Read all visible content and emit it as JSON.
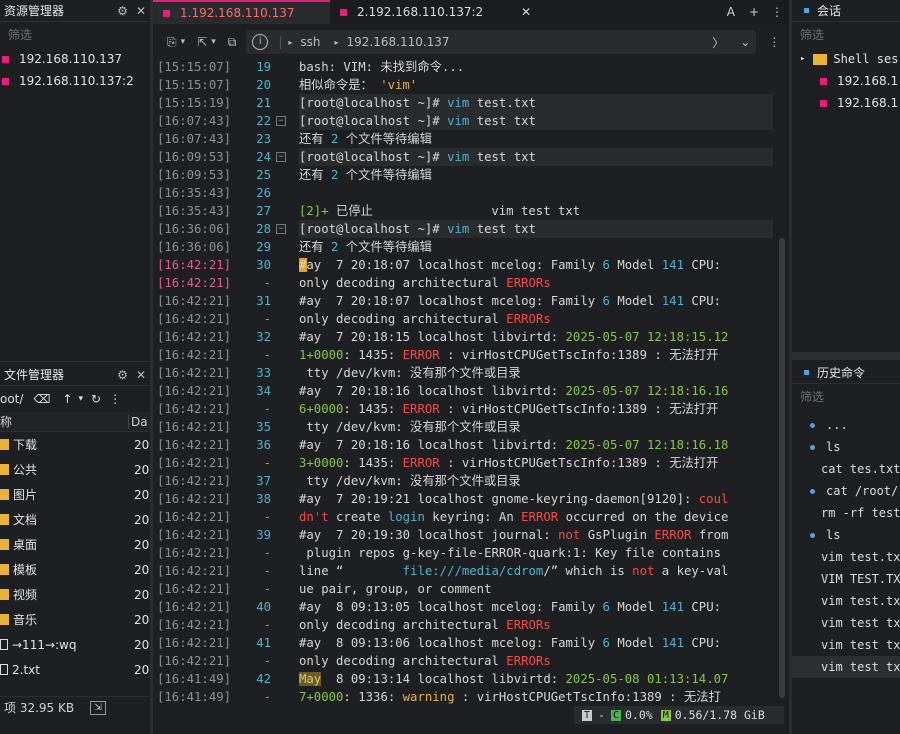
{
  "left_panel": {
    "title": "资源管理器",
    "sessions": [
      "192.168.110.137",
      "192.168.110.137:2"
    ]
  },
  "file_manager": {
    "title": "文件管理器",
    "path": "oot/",
    "col_name": "称",
    "col_date": "Da",
    "items": [
      {
        "name": "下载",
        "date": "20"
      },
      {
        "name": "公共",
        "date": "20"
      },
      {
        "name": "图片",
        "date": "20"
      },
      {
        "name": "文档",
        "date": "20"
      },
      {
        "name": "桌面",
        "date": "20"
      },
      {
        "name": "模板",
        "date": "20"
      },
      {
        "name": "视频",
        "date": "20"
      },
      {
        "name": "音乐",
        "date": "20"
      },
      {
        "name": "→111→:wq",
        "date": "20"
      },
      {
        "name": "2.txt",
        "date": "20"
      }
    ],
    "footer": "项 32.95 KB"
  },
  "tabs": [
    {
      "label": "1.192.168.110.137",
      "active": true
    },
    {
      "label": "2.192.168.110.137:2",
      "active": false
    }
  ],
  "breadcrumb": {
    "protocol": "ssh",
    "host": "192.168.110.137"
  },
  "terminal_lines": [
    {
      "ts": "[15:15:07]",
      "ln": "19",
      "parts": [
        [
          "",
          "bash: VIM: 未找到命令..."
        ]
      ]
    },
    {
      "ts": "[15:15:07]",
      "ln": "20",
      "parts": [
        [
          "",
          "相似命令是： "
        ],
        [
          "org",
          "'vim'"
        ]
      ]
    },
    {
      "ts": "[15:15:19]",
      "ln": "21",
      "hl": true,
      "parts": [
        [
          "",
          "[root@localhost ~]# "
        ],
        [
          "blue",
          "vim"
        ],
        [
          "",
          " test.txt"
        ]
      ]
    },
    {
      "ts": "[16:07:43]",
      "ln": "22",
      "fold": true,
      "hl": true,
      "parts": [
        [
          "",
          "[root@localhost ~]# "
        ],
        [
          "blue",
          "vim"
        ],
        [
          "",
          " test txt"
        ]
      ]
    },
    {
      "ts": "[16:07:43]",
      "ln": "23",
      "parts": [
        [
          "",
          "还有 "
        ],
        [
          "blue",
          "2"
        ],
        [
          "",
          " 个文件等待编辑"
        ]
      ]
    },
    {
      "ts": "[16:09:53]",
      "ln": "24",
      "fold": true,
      "hl": true,
      "parts": [
        [
          "",
          "[root@localhost ~]# "
        ],
        [
          "blue",
          "vim"
        ],
        [
          "",
          " test txt"
        ]
      ]
    },
    {
      "ts": "[16:09:53]",
      "ln": "25",
      "parts": [
        [
          "",
          "还有 "
        ],
        [
          "blue",
          "2"
        ],
        [
          "",
          " 个文件等待编辑"
        ]
      ]
    },
    {
      "ts": "[16:35:43]",
      "ln": "26",
      "parts": [
        [
          "",
          ""
        ]
      ]
    },
    {
      "ts": "[16:35:43]",
      "ln": "27",
      "parts": [
        [
          "grn",
          "[2]+"
        ],
        [
          "",
          " 已停止                vim test txt"
        ]
      ]
    },
    {
      "ts": "[16:36:06]",
      "ln": "28",
      "fold": true,
      "hl": true,
      "parts": [
        [
          "",
          "[root@localhost ~]# "
        ],
        [
          "blue",
          "vim"
        ],
        [
          "",
          " test txt"
        ]
      ]
    },
    {
      "ts": "[16:36:06]",
      "ln": "29",
      "parts": [
        [
          "",
          "还有 "
        ],
        [
          "blue",
          "2"
        ],
        [
          "",
          " 个文件等待编辑"
        ]
      ]
    },
    {
      "ts": "[16:42:21]",
      "ln": "30",
      "tscolor": "#e05f8c",
      "parts": [
        [
          "",
          "#ay  7 20:18:07 localhost mcelog: Family "
        ],
        [
          "blue",
          "6"
        ],
        [
          "",
          " Model "
        ],
        [
          "blue",
          "141"
        ],
        [
          "",
          " CPU: "
        ]
      ]
    },
    {
      "ts": "[16:42:21]",
      "ln": "-",
      "tscolor": "#e05f8c",
      "parts": [
        [
          "",
          "only decoding architectural "
        ],
        [
          "red",
          "ERRORs"
        ]
      ]
    },
    {
      "ts": "[16:42:21]",
      "ln": "31",
      "parts": [
        [
          "",
          "#ay  7 20:18:07 localhost mcelog: Family "
        ],
        [
          "blue",
          "6"
        ],
        [
          "",
          " Model "
        ],
        [
          "blue",
          "141"
        ],
        [
          "",
          " CPU: "
        ]
      ]
    },
    {
      "ts": "[16:42:21]",
      "ln": "-",
      "parts": [
        [
          "",
          "only decoding architectural "
        ],
        [
          "red",
          "ERRORs"
        ]
      ]
    },
    {
      "ts": "[16:42:21]",
      "ln": "32",
      "parts": [
        [
          "",
          "#ay  7 20:18:15 localhost libvirtd: "
        ],
        [
          "grn",
          "2025-05-07 12:18:15.12"
        ]
      ]
    },
    {
      "ts": "[16:42:21]",
      "ln": "-",
      "parts": [
        [
          "grn",
          "1+0000"
        ],
        [
          "",
          ": 1435: "
        ],
        [
          "red",
          "ERROR"
        ],
        [
          "",
          " : virHostCPUGetTscInfo:1389 : 无法打开"
        ]
      ]
    },
    {
      "ts": "[16:42:21]",
      "ln": "33",
      "parts": [
        [
          "",
          " tty /dev/kvm: 没有那个文件或目录"
        ]
      ]
    },
    {
      "ts": "[16:42:21]",
      "ln": "34",
      "parts": [
        [
          "",
          "#ay  7 20:18:16 localhost libvirtd: "
        ],
        [
          "grn",
          "2025-05-07 12:18:16.16"
        ]
      ]
    },
    {
      "ts": "[16:42:21]",
      "ln": "-",
      "parts": [
        [
          "grn",
          "6+0000"
        ],
        [
          "",
          ": 1435: "
        ],
        [
          "red",
          "ERROR"
        ],
        [
          "",
          " : virHostCPUGetTscInfo:1389 : 无法打开"
        ]
      ]
    },
    {
      "ts": "[16:42:21]",
      "ln": "35",
      "parts": [
        [
          "",
          " tty /dev/kvm: 没有那个文件或目录"
        ]
      ]
    },
    {
      "ts": "[16:42:21]",
      "ln": "36",
      "parts": [
        [
          "",
          "#ay  7 20:18:16 localhost libvirtd: "
        ],
        [
          "grn",
          "2025-05-07 12:18:16.18"
        ]
      ]
    },
    {
      "ts": "[16:42:21]",
      "ln": "-",
      "parts": [
        [
          "grn",
          "3+0000"
        ],
        [
          "",
          ": 1435: "
        ],
        [
          "red",
          "ERROR"
        ],
        [
          "",
          " : virHostCPUGetTscInfo:1389 : 无法打开"
        ]
      ]
    },
    {
      "ts": "[16:42:21]",
      "ln": "37",
      "parts": [
        [
          "",
          " tty /dev/kvm: 没有那个文件或目录"
        ]
      ]
    },
    {
      "ts": "[16:42:21]",
      "ln": "38",
      "parts": [
        [
          "",
          "#ay  7 20:19:21 localhost gnome-keyring-daemon[9120]: "
        ],
        [
          "red",
          "coul"
        ]
      ]
    },
    {
      "ts": "[16:42:21]",
      "ln": "-",
      "parts": [
        [
          "red",
          "dn't"
        ],
        [
          "",
          " create "
        ],
        [
          "blue",
          "login"
        ],
        [
          "",
          " keyring: An "
        ],
        [
          "red",
          "ERROR"
        ],
        [
          "",
          " occurred on the device"
        ]
      ]
    },
    {
      "ts": "[16:42:21]",
      "ln": "39",
      "parts": [
        [
          "",
          "#ay  7 20:19:30 localhost journal: "
        ],
        [
          "red",
          "not"
        ],
        [
          "",
          " GsPlugin "
        ],
        [
          "red",
          "ERROR"
        ],
        [
          "",
          " from"
        ]
      ]
    },
    {
      "ts": "[16:42:21]",
      "ln": "-",
      "parts": [
        [
          "",
          " plugin repos g-key-file-ERROR-quark:1: Key file contains "
        ]
      ]
    },
    {
      "ts": "[16:42:21]",
      "ln": "-",
      "parts": [
        [
          "",
          "line “        "
        ],
        [
          "blue",
          "file:///media/cdrom"
        ],
        [
          "",
          "/” which is "
        ],
        [
          "red",
          "not"
        ],
        [
          "",
          " a key-val"
        ]
      ]
    },
    {
      "ts": "[16:42:21]",
      "ln": "-",
      "parts": [
        [
          "",
          "ue pair, group, or comment"
        ]
      ]
    },
    {
      "ts": "[16:42:21]",
      "ln": "40",
      "parts": [
        [
          "",
          "#ay  8 09:13:05 localhost mcelog: Family "
        ],
        [
          "blue",
          "6"
        ],
        [
          "",
          " Model "
        ],
        [
          "blue",
          "141"
        ],
        [
          "",
          " CPU: "
        ]
      ]
    },
    {
      "ts": "[16:42:21]",
      "ln": "-",
      "parts": [
        [
          "",
          "only decoding architectural "
        ],
        [
          "red",
          "ERRORs"
        ]
      ]
    },
    {
      "ts": "[16:42:21]",
      "ln": "41",
      "parts": [
        [
          "",
          "#ay  8 09:13:06 localhost mcelog: Family "
        ],
        [
          "blue",
          "6"
        ],
        [
          "",
          " Model "
        ],
        [
          "blue",
          "141"
        ],
        [
          "",
          " CPU: "
        ]
      ]
    },
    {
      "ts": "[16:42:21]",
      "ln": "-",
      "parts": [
        [
          "",
          "only decoding architectural "
        ],
        [
          "red",
          "ERRORs"
        ]
      ]
    },
    {
      "ts": "[16:41:49]",
      "ln": "42",
      "parts": [
        [
          "yel",
          "May"
        ],
        [
          "",
          "  8 09:13:14 localhost libvirtd: "
        ],
        [
          "grn",
          "2025-05-08 01:13:14.07"
        ]
      ]
    },
    {
      "ts": "[16:41:49]",
      "ln": "-",
      "parts": [
        [
          "grn",
          "7+0000"
        ],
        [
          "",
          ": 1336: "
        ],
        [
          "org",
          "warning"
        ],
        [
          "",
          " : virHostCPUGetTscInfo:1389 : 无法打"
        ]
      ]
    }
  ],
  "status": {
    "cpu": "0.0%",
    "mem": "0.56/1.78 GiB"
  },
  "sessions_panel": {
    "title": "会话",
    "filter": "筛选",
    "folder": "Shell ses",
    "items": [
      "192.168.1",
      "192.168.1"
    ]
  },
  "history_panel": {
    "title": "历史命令",
    "filter": "筛选",
    "items": [
      "...",
      "ls",
      "cat tes.txt",
      "cat /root/",
      "rm -rf test",
      "ls",
      "vim test.tx",
      "VIM TEST.TX",
      "vim test.tx",
      "vim test tx",
      "vim test tx",
      "vim test tx"
    ]
  },
  "colors": {
    "accent": "#e6207a",
    "blue": "#4fb3c9",
    "green": "#8bc34a",
    "red": "#f14c4c"
  }
}
